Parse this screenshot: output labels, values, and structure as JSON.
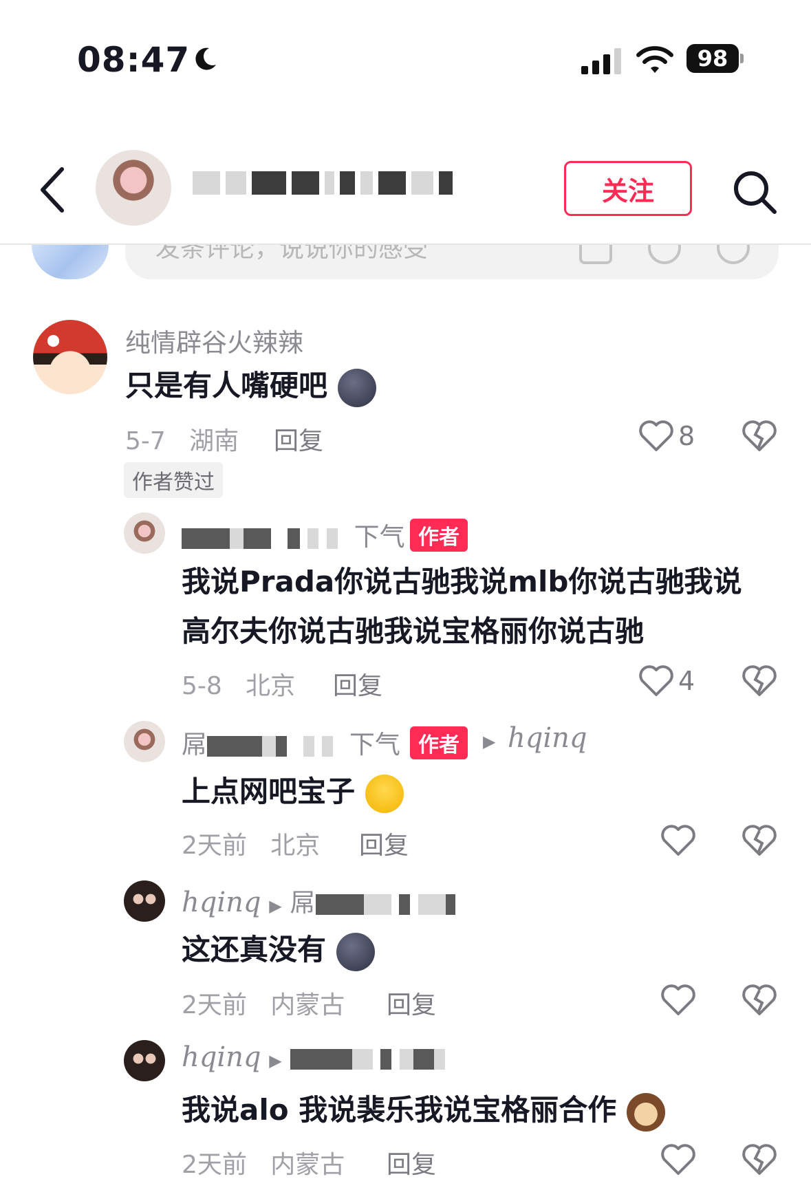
{
  "status": {
    "time": "08:47",
    "battery": "98",
    "icons": [
      "moon-icon",
      "signal-icon",
      "wifi-icon",
      "battery-icon"
    ]
  },
  "header": {
    "follow_label": "关注",
    "icons": [
      "back-icon",
      "search-icon"
    ]
  },
  "composer": {
    "placeholder": "发条评论，说说你的感受"
  },
  "comments": [
    {
      "user": "纯情辟谷火辣辣",
      "text": "只是有人嘴硬吧",
      "date": "5-7",
      "location": "湖南",
      "reply": "回复",
      "likes": "8",
      "liked_tag": "作者赞过"
    },
    {
      "user_suffix": "下气",
      "author_tag": "作者",
      "text_line1": "我说Prada你说古驰我说mlb你说古驰我说",
      "text_line2": "高尔夫你说古驰我说宝格丽你说古驰",
      "date": "5-8",
      "location": "北京",
      "reply": "回复",
      "likes": "4"
    },
    {
      "user_prefix": "屌",
      "user_suffix": "下气",
      "author_tag": "作者",
      "reply_to": "hqinq",
      "text": "上点网吧宝子",
      "date": "2天前",
      "location": "北京",
      "reply": "回复"
    },
    {
      "user": "hqinq",
      "reply_to_prefix": "屌",
      "text": "这还真没有",
      "date": "2天前",
      "location": "内蒙古",
      "reply": "回复"
    },
    {
      "user": "hqinq",
      "text": "我说alo 我说裴乐我说宝格丽合作",
      "date": "2天前",
      "location": "内蒙古",
      "reply": "回复"
    }
  ],
  "colors": {
    "accent": "#fe2c55",
    "text": "#161823",
    "muted": "#a0a0a6"
  }
}
